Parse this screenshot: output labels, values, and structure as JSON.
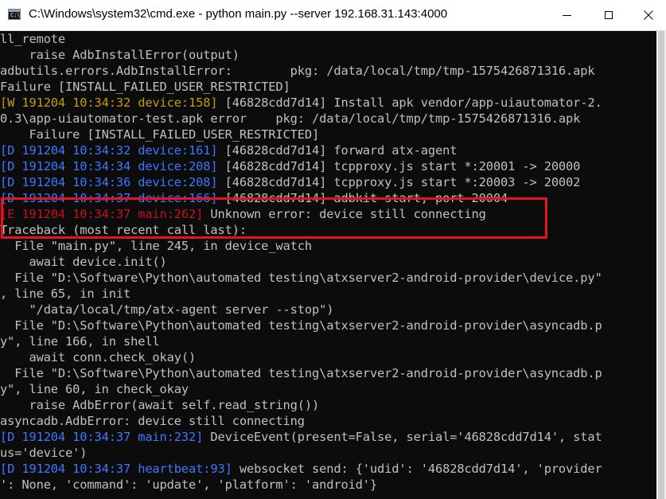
{
  "window": {
    "title": "C:\\Windows\\system32\\cmd.exe - python  main.py --server 192.168.31.143:4000"
  },
  "console": {
    "lines": [
      [
        {
          "t": "ll_remote"
        }
      ],
      [
        {
          "t": "    raise AdbInstallError(output)"
        }
      ],
      [
        {
          "t": "adbutils.errors.AdbInstallError:        pkg: /data/local/tmp/tmp-1575426871316.apk"
        }
      ],
      [
        {
          "t": "Failure [INSTALL_FAILED_USER_RESTRICTED]"
        }
      ],
      [
        {
          "t": "[W 191204 10:34:32 device:158]",
          "c": "yellow"
        },
        {
          "t": " [46828cdd7d14] Install apk vendor/app-uiautomator-2."
        }
      ],
      [
        {
          "t": "0.3\\app-uiautomator-test.apk error    pkg: /data/local/tmp/tmp-1575426871316.apk"
        }
      ],
      [
        {
          "t": "    Failure [INSTALL_FAILED_USER_RESTRICTED]"
        }
      ],
      [
        {
          "t": "[D 191204 10:34:32 device:161]",
          "c": "blue"
        },
        {
          "t": " [46828cdd7d14] forward atx-agent"
        }
      ],
      [
        {
          "t": "[D 191204 10:34:34 device:208]",
          "c": "blue"
        },
        {
          "t": " [46828cdd7d14] tcpproxy.js start *:20001 -> 20000"
        }
      ],
      [
        {
          "t": "[D 191204 10:34:36 device:208]",
          "c": "blue"
        },
        {
          "t": " [46828cdd7d14] tcpproxy.js start *:20003 -> 20002"
        }
      ],
      [
        {
          "t": "[D 191204 10:34:37 device:166]",
          "c": "blue"
        },
        {
          "t": " [46828cdd7d14] adbkit start, port 20004"
        }
      ],
      [
        {
          "t": "[E 191204 10:34:37 main:262]",
          "c": "red"
        },
        {
          "t": " Unknown error: device still connecting"
        }
      ],
      [
        {
          "t": "Traceback (most recent call last):"
        }
      ],
      [
        {
          "t": "  File \"main.py\", line 245, in device_watch"
        }
      ],
      [
        {
          "t": "    await device.init()"
        }
      ],
      [
        {
          "t": "  File \"D:\\Software\\Python\\automated testing\\atxserver2-android-provider\\device.py\""
        }
      ],
      [
        {
          "t": ", line 65, in init"
        }
      ],
      [
        {
          "t": "    \"/data/local/tmp/atx-agent server --stop\")"
        }
      ],
      [
        {
          "t": "  File \"D:\\Software\\Python\\automated testing\\atxserver2-android-provider\\asyncadb.p"
        }
      ],
      [
        {
          "t": "y\", line 166, in shell"
        }
      ],
      [
        {
          "t": "    await conn.check_okay()"
        }
      ],
      [
        {
          "t": "  File \"D:\\Software\\Python\\automated testing\\atxserver2-android-provider\\asyncadb.p"
        }
      ],
      [
        {
          "t": "y\", line 60, in check_okay"
        }
      ],
      [
        {
          "t": "    raise AdbError(await self.read_string())"
        }
      ],
      [
        {
          "t": "asyncadb.AdbError: device still connecting"
        }
      ],
      [
        {
          "t": "[D 191204 10:34:37 main:232]",
          "c": "blue"
        },
        {
          "t": " DeviceEvent(present=False, serial='46828cdd7d14', stat"
        }
      ],
      [
        {
          "t": "us='device')"
        }
      ],
      [
        {
          "t": "[D 191204 10:34:37 heartbeat:93]",
          "c": "blue"
        },
        {
          "t": " websocket send: {'udid': '46828cdd7d14', 'provider"
        }
      ],
      [
        {
          "t": "': None, 'command': 'update', 'platform': 'android'}"
        }
      ]
    ]
  },
  "colors": {
    "background": "#0c0c0c",
    "text": "#c0c0c0",
    "yellow": "#c19c00",
    "blue": "#3b78ff",
    "red": "#c50f1f",
    "highlight": "#e81123"
  },
  "icons": {
    "app": "cmd-icon",
    "minimize": "minimize-icon",
    "maximize": "maximize-icon",
    "close": "close-icon"
  }
}
